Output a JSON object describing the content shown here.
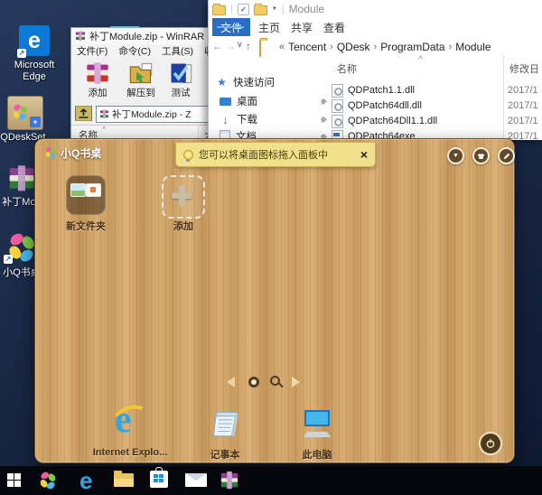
{
  "icons": {
    "close": "×",
    "back": "←",
    "forward": "→",
    "dropdown": "∨",
    "up": "↑",
    "breadcrumb_prefix": "«",
    "breadcrumb_sep": "›",
    "caret_down": "▼",
    "sort_asc": "^",
    "check": "✓",
    "star": "★",
    "down_arrow": "↓",
    "shortcut": "↗",
    "edge_e": "e",
    "qat_sep": "|"
  },
  "desktop_icons": {
    "edge": "Microsoft Edge",
    "qdeskset": "QDeskSet...",
    "patch": "补丁Mod",
    "xiaoq": "小Q书桌"
  },
  "winrar": {
    "title": "补丁Module.zip - WinRAR",
    "menu": [
      "文件(F)",
      "命令(C)",
      "工具(S)",
      "收"
    ],
    "toolbar": [
      {
        "label": "添加"
      },
      {
        "label": "解压到"
      },
      {
        "label": "测试"
      }
    ],
    "address_value": "补丁Module.zip - Z",
    "columns": {
      "name": "名称",
      "size": "大"
    }
  },
  "explorer": {
    "window_title": "Module",
    "tabs": [
      {
        "label": "文件"
      },
      {
        "label": "主页"
      },
      {
        "label": "共享"
      },
      {
        "label": "查看"
      }
    ],
    "breadcrumb": {
      "items": [
        "Tencent",
        "QDesk",
        "ProgramData",
        "Module"
      ]
    },
    "sidebar": {
      "quick_access": "快速访问",
      "items": [
        {
          "label": "桌面"
        },
        {
          "label": "下载"
        },
        {
          "label": "文档"
        }
      ]
    },
    "list": {
      "name_header": "名称",
      "date_header": "修改日",
      "files": [
        {
          "name": "QDPatch1.1.dll",
          "date": "2017/1"
        },
        {
          "name": "QDPatch64dll.dll",
          "date": "2017/1"
        },
        {
          "name": "QDPatch64Dll1.1.dll",
          "date": "2017/1"
        },
        {
          "name": "QDPatch64exe",
          "date": "2017/1"
        }
      ]
    }
  },
  "panel": {
    "title": "小Q书桌",
    "tooltip": {
      "text": "您可以将桌面图标拖入面板中"
    },
    "tiles": [
      {
        "label": "新文件夹"
      },
      {
        "label": "添加"
      }
    ],
    "dock": [
      {
        "label": "Internet Explo..."
      },
      {
        "label": "记事本"
      },
      {
        "label": "此电脑"
      }
    ]
  }
}
